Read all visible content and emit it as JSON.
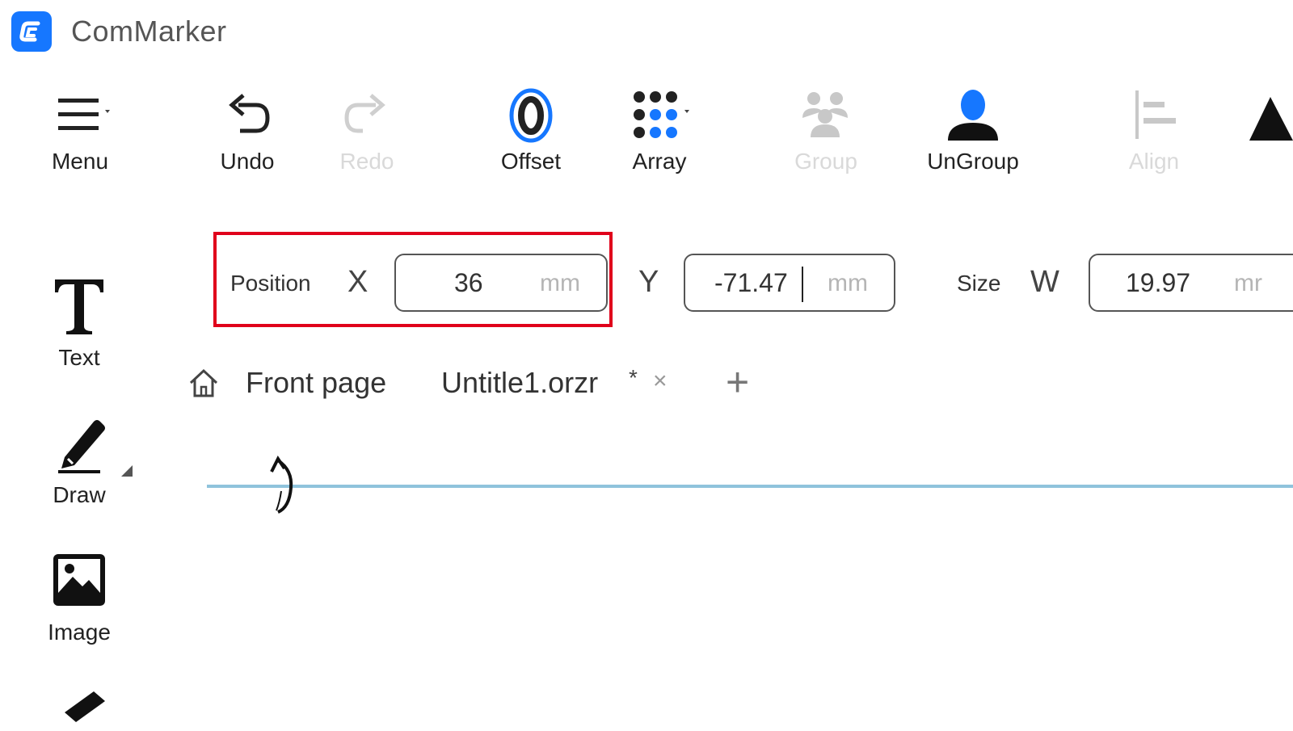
{
  "app": {
    "title": "ComMarker",
    "logo_icon": "commarker-logo-icon",
    "accent_color": "#1677ff"
  },
  "toolbar": {
    "items": [
      {
        "label": "Menu",
        "icon": "hamburger-menu-icon",
        "enabled": true
      },
      {
        "label": "Undo",
        "icon": "undo-icon",
        "enabled": true
      },
      {
        "label": "Redo",
        "icon": "redo-icon",
        "enabled": false
      },
      {
        "label": "Offset",
        "icon": "offset-icon",
        "enabled": true
      },
      {
        "label": "Array",
        "icon": "array-grid-icon",
        "enabled": true
      },
      {
        "label": "Group",
        "icon": "group-users-icon",
        "enabled": false
      },
      {
        "label": "UnGroup",
        "icon": "ungroup-user-icon",
        "enabled": true
      },
      {
        "label": "Align",
        "icon": "align-left-icon",
        "enabled": false
      }
    ]
  },
  "properties": {
    "position_label": "Position",
    "x_label": "X",
    "x_value": "36",
    "y_label": "Y",
    "y_value": "-71.47",
    "unit": "mm",
    "size_label": "Size",
    "w_label": "W",
    "w_value": "19.97",
    "w_unit_partial": "mr",
    "highlight_color": "#e0001b"
  },
  "tabs": {
    "home_icon": "home-icon",
    "front_page": "Front page",
    "file_name": "Untitle1.orzr",
    "modified_marker": "*",
    "close_glyph": "×",
    "add_glyph": "+"
  },
  "sidebar": {
    "items": [
      {
        "label": "Text",
        "icon": "text-tool-icon"
      },
      {
        "label": "Draw",
        "icon": "pencil-draw-icon"
      },
      {
        "label": "Image",
        "icon": "image-icon"
      }
    ]
  }
}
